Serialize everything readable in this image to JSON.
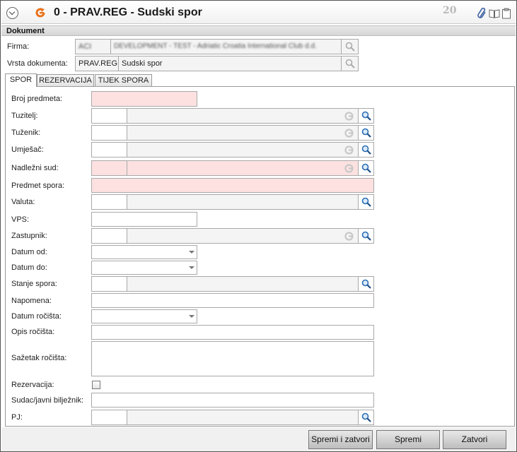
{
  "window": {
    "title": "0 - PRAV.REG - Sudski spor",
    "counter": "20"
  },
  "section": {
    "title": "Dokument"
  },
  "header_fields": {
    "firma_label": "Firma:",
    "firma_code": "ACI",
    "firma_name": "DEVELOPMENT - TEST - Adriatic Croatia International Club d.d.",
    "vrsta_label": "Vrsta dokumenta:",
    "vrsta_code": "PRAV.REG",
    "vrsta_name": "Sudski spor"
  },
  "tabs": [
    {
      "label": "SPOR",
      "active": true
    },
    {
      "label": "REZERVACIJA",
      "active": false
    },
    {
      "label": "TIJEK SPORA",
      "active": false
    }
  ],
  "form": {
    "broj_predmeta": "Broj predmeta:",
    "tuzitelj": "Tuzitelj:",
    "tuzenik": "Tuženik:",
    "umjesac": "Umješač:",
    "nadlezni_sud": "Nadležni sud:",
    "predmet_spora": "Predmet spora:",
    "valuta": "Valuta:",
    "vps": "VPS:",
    "zastupnik": "Zastupnik:",
    "datum_od": "Datum od:",
    "datum_do": "Datum do:",
    "stanje_spora": "Stanje spora:",
    "napomena": "Napomena:",
    "datum_rocista": "Datum ročišta:",
    "opis_rocista": "Opis ročišta:",
    "sazetak_rocista": "Sažetak ročišta:",
    "rezervacija": "Rezervacija:",
    "sudac": "Sudac/javni bilježnik:",
    "pj": "PJ:"
  },
  "buttons": {
    "save_close": "Spremi i zatvori",
    "save": "Spremi",
    "close": "Zatvori"
  },
  "colors": {
    "required_bg": "#fde1e1",
    "accent_orange": "#e8731c",
    "search_blue": "#2a6db5"
  }
}
